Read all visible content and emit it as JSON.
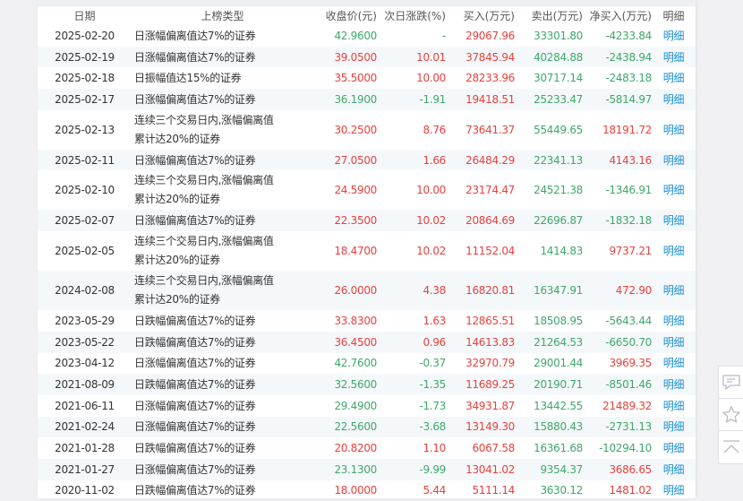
{
  "headers": {
    "date": "日期",
    "type": "上榜类型",
    "close": "收盘价(元)",
    "next": "次日涨跌(%)",
    "buy": "买入(万元)",
    "sell": "卖出(万元)",
    "net": "净买入(万元)",
    "detail": "明细"
  },
  "colors": {
    "up": "#e8413d",
    "down": "#3ea86a",
    "link": "#1a8fd4"
  },
  "rows": [
    {
      "date": "2025-02-20",
      "type": "日涨幅偏离值达7%的证券",
      "close": "42.9600",
      "close_dir": "down",
      "next": "-",
      "next_dir": "down",
      "buy": "29067.96",
      "sell": "33301.80",
      "net": "-4233.84",
      "net_dir": "down",
      "detail": "明细"
    },
    {
      "date": "2025-02-19",
      "type": "日涨幅偏离值达7%的证券",
      "close": "39.0500",
      "close_dir": "up",
      "next": "10.01",
      "next_dir": "up",
      "buy": "37845.94",
      "sell": "40284.88",
      "net": "-2438.94",
      "net_dir": "down",
      "detail": "明细"
    },
    {
      "date": "2025-02-18",
      "type": "日振幅值达15%的证券",
      "close": "35.5000",
      "close_dir": "up",
      "next": "10.00",
      "next_dir": "up",
      "buy": "28233.96",
      "sell": "30717.14",
      "net": "-2483.18",
      "net_dir": "down",
      "detail": "明细"
    },
    {
      "date": "2025-02-17",
      "type": "日涨幅偏离值达7%的证券",
      "close": "36.1900",
      "close_dir": "down",
      "next": "-1.91",
      "next_dir": "down",
      "buy": "19418.51",
      "sell": "25233.47",
      "net": "-5814.97",
      "net_dir": "down",
      "detail": "明细"
    },
    {
      "date": "2025-02-13",
      "type": "连续三个交易日内,涨幅偏离值累计达20%的证券",
      "close": "30.2500",
      "close_dir": "up",
      "next": "8.76",
      "next_dir": "up",
      "buy": "73641.37",
      "sell": "55449.65",
      "net": "18191.72",
      "net_dir": "up",
      "detail": "明细"
    },
    {
      "date": "2025-02-11",
      "type": "日涨幅偏离值达7%的证券",
      "close": "27.0500",
      "close_dir": "up",
      "next": "1.66",
      "next_dir": "up",
      "buy": "26484.29",
      "sell": "22341.13",
      "net": "4143.16",
      "net_dir": "up",
      "detail": "明细"
    },
    {
      "date": "2025-02-10",
      "type": "连续三个交易日内,涨幅偏离值累计达20%的证券",
      "close": "24.5900",
      "close_dir": "up",
      "next": "10.00",
      "next_dir": "up",
      "buy": "23174.47",
      "sell": "24521.38",
      "net": "-1346.91",
      "net_dir": "down",
      "detail": "明细"
    },
    {
      "date": "2025-02-07",
      "type": "日涨幅偏离值达7%的证券",
      "close": "22.3500",
      "close_dir": "up",
      "next": "10.02",
      "next_dir": "up",
      "buy": "20864.69",
      "sell": "22696.87",
      "net": "-1832.18",
      "net_dir": "down",
      "detail": "明细"
    },
    {
      "date": "2025-02-05",
      "type": "连续三个交易日内,涨幅偏离值累计达20%的证券",
      "close": "18.4700",
      "close_dir": "up",
      "next": "10.02",
      "next_dir": "up",
      "buy": "11152.04",
      "sell": "1414.83",
      "net": "9737.21",
      "net_dir": "up",
      "detail": "明细"
    },
    {
      "date": "2024-02-08",
      "type": "连续三个交易日内,涨幅偏离值累计达20%的证券",
      "close": "26.0000",
      "close_dir": "up",
      "next": "4.38",
      "next_dir": "up",
      "buy": "16820.81",
      "sell": "16347.91",
      "net": "472.90",
      "net_dir": "up",
      "detail": "明细"
    },
    {
      "date": "2023-05-29",
      "type": "日跌幅偏离值达7%的证券",
      "close": "33.8300",
      "close_dir": "up",
      "next": "1.63",
      "next_dir": "up",
      "buy": "12865.51",
      "sell": "18508.95",
      "net": "-5643.44",
      "net_dir": "down",
      "detail": "明细"
    },
    {
      "date": "2023-05-22",
      "type": "日跌幅偏离值达7%的证券",
      "close": "36.4500",
      "close_dir": "up",
      "next": "0.96",
      "next_dir": "up",
      "buy": "14613.83",
      "sell": "21264.53",
      "net": "-6650.70",
      "net_dir": "down",
      "detail": "明细"
    },
    {
      "date": "2023-04-12",
      "type": "日涨幅偏离值达7%的证券",
      "close": "42.7600",
      "close_dir": "down",
      "next": "-0.37",
      "next_dir": "down",
      "buy": "32970.79",
      "sell": "29001.44",
      "net": "3969.35",
      "net_dir": "up",
      "detail": "明细"
    },
    {
      "date": "2021-08-09",
      "type": "日跌幅偏离值达7%的证券",
      "close": "32.5600",
      "close_dir": "down",
      "next": "-1.35",
      "next_dir": "down",
      "buy": "11689.25",
      "sell": "20190.71",
      "net": "-8501.46",
      "net_dir": "down",
      "detail": "明细"
    },
    {
      "date": "2021-06-11",
      "type": "日涨幅偏离值达7%的证券",
      "close": "29.4900",
      "close_dir": "down",
      "next": "-1.73",
      "next_dir": "down",
      "buy": "34931.87",
      "sell": "13442.55",
      "net": "21489.32",
      "net_dir": "up",
      "detail": "明细"
    },
    {
      "date": "2021-02-24",
      "type": "日涨幅偏离值达7%的证券",
      "close": "22.5600",
      "close_dir": "down",
      "next": "-3.68",
      "next_dir": "down",
      "buy": "13149.30",
      "sell": "15880.43",
      "net": "-2731.13",
      "net_dir": "down",
      "detail": "明细"
    },
    {
      "date": "2021-01-28",
      "type": "日跌幅偏离值达7%的证券",
      "close": "20.8200",
      "close_dir": "up",
      "next": "1.10",
      "next_dir": "up",
      "buy": "6067.58",
      "sell": "16361.68",
      "net": "-10294.10",
      "net_dir": "down",
      "detail": "明细"
    },
    {
      "date": "2021-01-27",
      "type": "日涨幅偏离值达7%的证券",
      "close": "23.1300",
      "close_dir": "down",
      "next": "-9.99",
      "next_dir": "down",
      "buy": "13041.02",
      "sell": "9354.37",
      "net": "3686.65",
      "net_dir": "up",
      "detail": "明细"
    },
    {
      "date": "2020-11-02",
      "type": "日跌幅偏离值达7%的证券",
      "close": "18.0000",
      "close_dir": "up",
      "next": "5.44",
      "next_dir": "up",
      "buy": "5111.14",
      "sell": "3630.12",
      "net": "1481.02",
      "net_dir": "up",
      "detail": "明细"
    }
  ]
}
